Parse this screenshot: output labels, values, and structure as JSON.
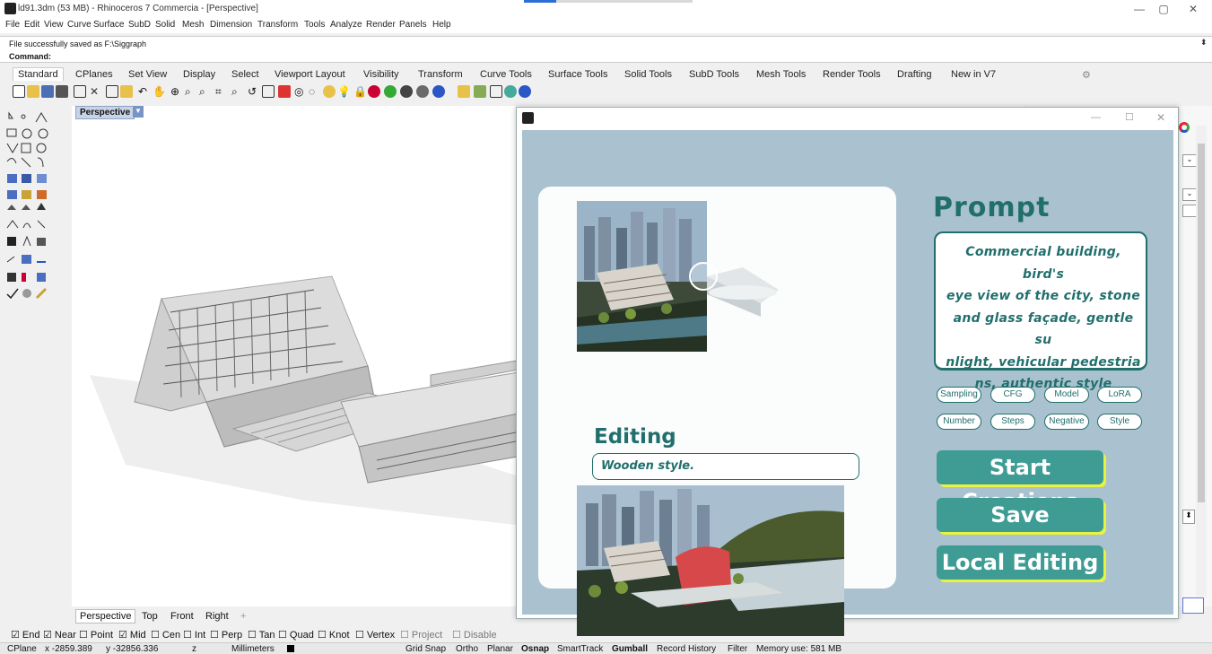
{
  "window": {
    "title": "ld91.3dm (53 MB) - Rhinoceros 7 Commercia - [Perspective]",
    "controls": [
      "—",
      "▢",
      "✕"
    ]
  },
  "menu": [
    "File",
    "Edit",
    "View",
    "Curve",
    "Surface",
    "SubD",
    "Solid",
    "Mesh",
    "Dimension",
    "Transform",
    "Tools",
    "Analyze",
    "Render",
    "Panels",
    "Help"
  ],
  "command": {
    "history": "File successfully saved as F:\\Siggraph",
    "prompt": "Command:"
  },
  "toolbar_tabs": [
    "Standard",
    "CPlanes",
    "Set View",
    "Display",
    "Select",
    "Viewport Layout",
    "Visibility",
    "Transform",
    "Curve Tools",
    "Surface Tools",
    "Solid Tools",
    "SubD Tools",
    "Mesh Tools",
    "Render Tools",
    "Drafting",
    "New in V7"
  ],
  "viewport": {
    "label": "Perspective",
    "tabs": [
      "Perspective",
      "Top",
      "Front",
      "Right"
    ],
    "add_tab": "+"
  },
  "osnap": {
    "items": [
      {
        "label": "End",
        "checked": true
      },
      {
        "label": "Near",
        "checked": true
      },
      {
        "label": "Point",
        "checked": false
      },
      {
        "label": "Mid",
        "checked": true
      },
      {
        "label": "Cen",
        "checked": false
      },
      {
        "label": "Int",
        "checked": false
      },
      {
        "label": "Perp",
        "checked": false
      },
      {
        "label": "Tan",
        "checked": false
      },
      {
        "label": "Quad",
        "checked": false
      },
      {
        "label": "Knot",
        "checked": false
      },
      {
        "label": "Vertex",
        "checked": false
      },
      {
        "label": "Project",
        "checked": false
      },
      {
        "label": "Disable",
        "checked": false
      }
    ]
  },
  "status": {
    "cplane": "CPlane",
    "x": "x -2859.389",
    "y": "y -32856.336",
    "z": "z",
    "units": "Millimeters",
    "grid_snap": "Grid Snap",
    "ortho": "Ortho",
    "planar": "Planar",
    "osnap": "Osnap",
    "smarttrack": "SmartTrack",
    "gumball": "Gumball",
    "record_history": "Record History",
    "filter": "Filter",
    "memory": "Memory use: 581 MB"
  },
  "plugin": {
    "window_controls": [
      "—",
      "☐",
      "✕"
    ],
    "prompt_title": "Prompt",
    "prompt_text": "Commercial building, bird's eye view of the city, stone and glass façade, gentle su nlight, vehicular pedestria ns, authentic style",
    "prompt_lines": [
      "Commercial building, bird's",
      "eye view of the city, stone",
      "and glass façade, gentle su",
      "nlight, vehicular pedestria",
      "ns, authentic style"
    ],
    "params_row1": [
      "Sampling",
      "CFG",
      "Model",
      "LoRA"
    ],
    "params_row2": [
      "Number",
      "Steps",
      "Negative",
      "Style"
    ],
    "buttons": {
      "start": "Start Creations",
      "save": "Save",
      "local": "Local Editing"
    },
    "editing_title": "Editing",
    "editing_value": "Wooden style.",
    "colors": {
      "background": "#aac1cf",
      "accent": "#216f6c",
      "button": "#3f9c95",
      "button_shadow": "#e9f23d"
    }
  }
}
